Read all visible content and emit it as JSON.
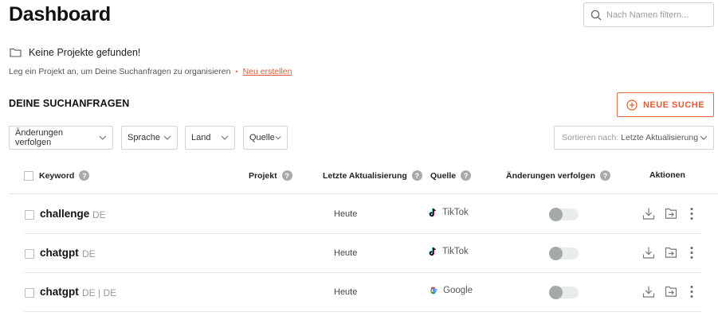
{
  "header": {
    "title": "Dashboard",
    "search_placeholder": "Nach Namen filtern..."
  },
  "projects": {
    "empty_text": "Keine Projekte gefunden!",
    "hint_text": "Leg ein Projekt an, um Deine Suchanfragen zu organisieren",
    "separator": "•",
    "create_link": "Neu erstellen"
  },
  "queries": {
    "section_title": "DEINE SUCHANFRAGEN",
    "new_button": "NEUE SUCHE"
  },
  "filters": {
    "track_changes": "Änderungen verfolgen",
    "language": "Sprache",
    "country": "Land",
    "source": "Quelle"
  },
  "sort": {
    "label": "Sortieren nach:",
    "value": "Letzte Aktualisierung"
  },
  "table": {
    "columns": {
      "keyword": "Keyword",
      "project": "Projekt",
      "last_update": "Letzte Aktualisierung",
      "source": "Quelle",
      "track_changes": "Änderungen verfolgen",
      "actions": "Aktionen"
    },
    "rows": [
      {
        "keyword": "challenge",
        "lang": "DE",
        "updated": "Heute",
        "source": "TikTok",
        "source_icon": "tiktok-icon",
        "tracking": false
      },
      {
        "keyword": "chatgpt",
        "lang": "DE",
        "updated": "Heute",
        "source": "TikTok",
        "source_icon": "tiktok-icon",
        "tracking": false
      },
      {
        "keyword": "chatgpt",
        "lang": "DE | DE",
        "updated": "Heute",
        "source": "Google",
        "source_icon": "google-icon",
        "tracking": false
      }
    ]
  },
  "colors": {
    "accent": "#e05a34",
    "border": "#d4d4d4",
    "toggle_off": "#a3aaa9"
  }
}
